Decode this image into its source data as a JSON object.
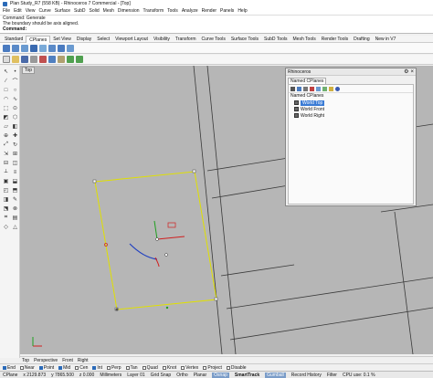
{
  "window": {
    "title": "Plan Study_R7 (558 KB) - Rhinoceros 7 Commercial - [Top]"
  },
  "menu": [
    "File",
    "Edit",
    "View",
    "Curve",
    "Surface",
    "SubD",
    "Solid",
    "Mesh",
    "Dimension",
    "Transform",
    "Tools",
    "Analyze",
    "Render",
    "Panels",
    "Help"
  ],
  "command": {
    "lines": [
      "Command: Generate",
      "The boundary should be axis aligned."
    ],
    "prompt": "Command:"
  },
  "tabs": [
    "Standard",
    "CPlanes",
    "Set View",
    "Display",
    "Select",
    "Viewport Layout",
    "Visibility",
    "Transform",
    "Curve Tools",
    "Surface Tools",
    "SubD Tools",
    "Mesh Tools",
    "Render Tools",
    "Drafting",
    "New in V7"
  ],
  "active_tab": "CPlanes",
  "viewport": {
    "label": "Top"
  },
  "panel": {
    "title": "Rhinoceros",
    "tab": "Named CPlanes",
    "header": "Named CPlanes",
    "items": [
      {
        "name": "World Top",
        "selected": true
      },
      {
        "name": "World Front",
        "selected": false
      },
      {
        "name": "World Right",
        "selected": false
      }
    ]
  },
  "viewport_tabs": [
    "Top",
    "Perspective",
    "Front",
    "Right"
  ],
  "osnaps": [
    {
      "label": "End",
      "on": true
    },
    {
      "label": "Near",
      "on": false
    },
    {
      "label": "Point",
      "on": true
    },
    {
      "label": "Mid",
      "on": true
    },
    {
      "label": "Cen",
      "on": false
    },
    {
      "label": "Int",
      "on": true
    },
    {
      "label": "Perp",
      "on": false
    },
    {
      "label": "Tan",
      "on": false
    },
    {
      "label": "Quad",
      "on": false
    },
    {
      "label": "Knot",
      "on": false
    },
    {
      "label": "Vertex",
      "on": false
    },
    {
      "label": "Project",
      "on": false
    },
    {
      "label": "Disable",
      "on": false
    }
  ],
  "status": {
    "cplane": "CPlane",
    "x": "x 2129.873",
    "y": "y 7865.500",
    "z": "z 0.000",
    "units": "Millimeters",
    "layer": "Layer 01",
    "items": [
      "Grid Snap",
      "Ortho",
      "Planar",
      "Osnap",
      "SmartTrack",
      "Gumball",
      "Record History",
      "Filter",
      "CPU use: 0.1 %"
    ],
    "highlighted": [
      "Osnap",
      "Gumball"
    ],
    "bold": [
      "SmartTrack"
    ]
  },
  "colors": {
    "viewport_bg": "#b6b6b6",
    "selection": "#e0e000",
    "accent": "#2a6ab8"
  }
}
